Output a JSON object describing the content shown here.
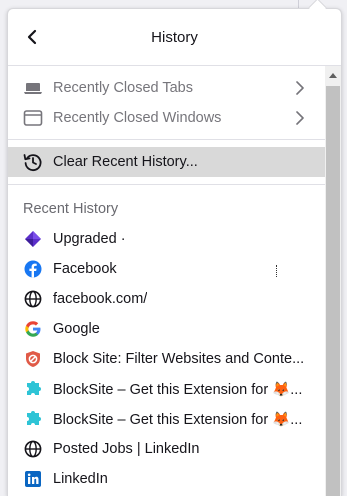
{
  "header": {
    "title": "History"
  },
  "menu": {
    "recently_closed_tabs": "Recently Closed Tabs",
    "recently_closed_windows": "Recently Closed Windows",
    "clear_recent_history": "Clear Recent History..."
  },
  "recent_history": {
    "heading": "Recent History",
    "items": [
      {
        "label": "Upgraded ·",
        "icon": "purple-diamond-icon"
      },
      {
        "label": "Facebook",
        "icon": "facebook-icon"
      },
      {
        "label": "facebook.com/",
        "icon": "globe-icon"
      },
      {
        "label": "Google",
        "icon": "google-icon"
      },
      {
        "label": "Block Site: Filter Websites and Conte...",
        "icon": "blocksite-shield-icon"
      },
      {
        "label": "BlockSite – Get this Extension for 🦊...",
        "icon": "blocksite-puzzle-icon"
      },
      {
        "label": "BlockSite – Get this Extension for 🦊...",
        "icon": "blocksite-puzzle-icon"
      },
      {
        "label": "Posted Jobs | LinkedIn",
        "icon": "globe-icon"
      },
      {
        "label": "LinkedIn",
        "icon": "linkedin-icon"
      }
    ]
  },
  "colors": {
    "highlight": "#d9d9d9",
    "facebook": "#1877f2",
    "linkedin": "#0a66c2",
    "blocksite": "#e05a47",
    "puzzle": "#2ec4d6"
  }
}
